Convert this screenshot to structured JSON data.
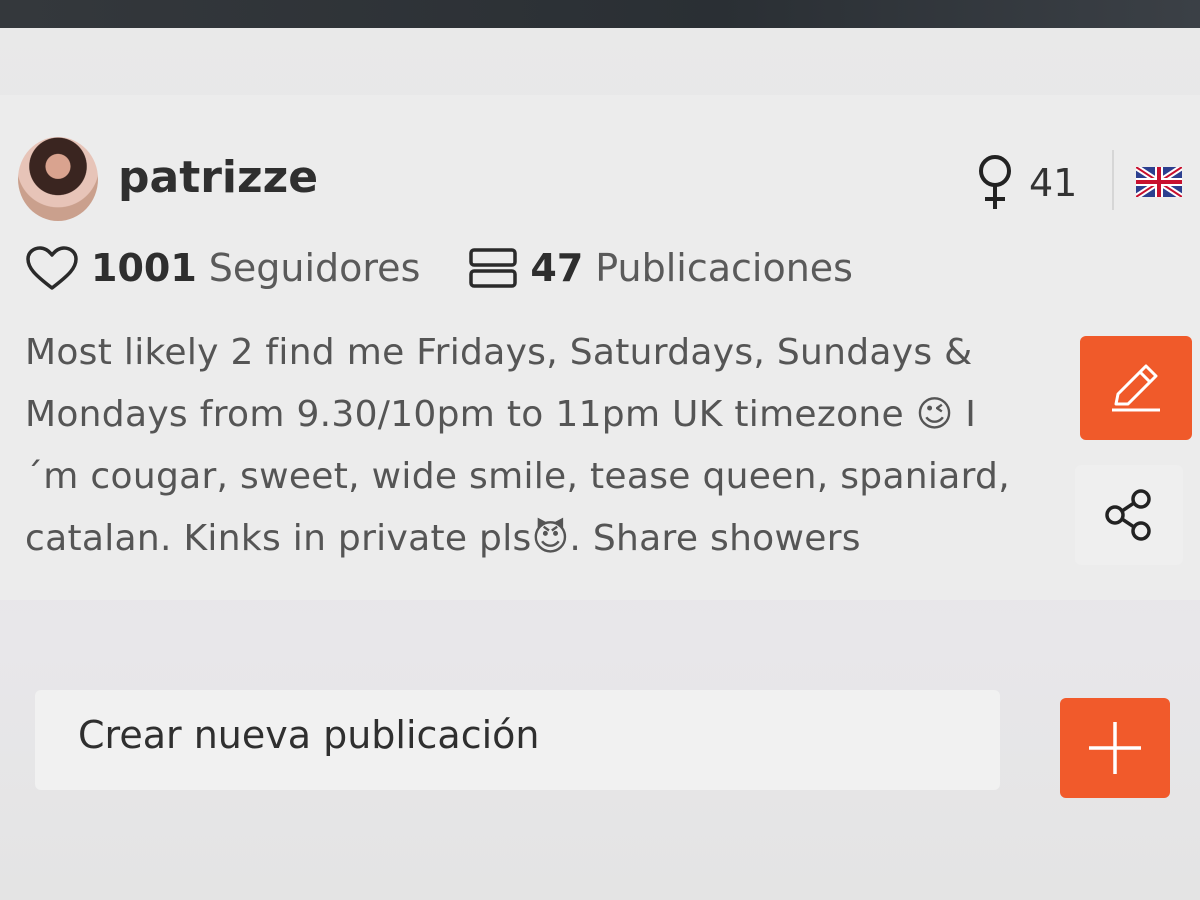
{
  "profile": {
    "username": "patrizze",
    "age": "41",
    "gender_icon": "female-symbol-icon",
    "flag_icon": "uk-flag-icon"
  },
  "stats": {
    "followers_count": "1001",
    "followers_label": "Seguidores",
    "posts_count": "47",
    "posts_label": "Publicaciones"
  },
  "bio": {
    "lines": [
      "Most likely 2 find me Fridays, Saturdays, Sundays &",
      "Mondays from 9.30/10pm to 11pm UK timezone 😉 I",
      "´m cougar, sweet, wide smile, tease queen, spaniard,",
      "catalan. Kinks in private pls😈. Share showers"
    ]
  },
  "actions": {
    "edit_icon": "pencil-icon",
    "share_icon": "share-icon"
  },
  "composer": {
    "label": "Crear nueva publicación",
    "add_icon": "plus-icon"
  },
  "colors": {
    "accent": "#f05a2a",
    "background": "#ececec"
  }
}
